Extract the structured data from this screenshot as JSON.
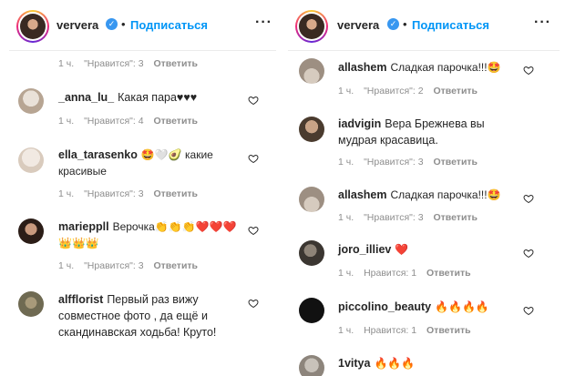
{
  "left": {
    "header": {
      "username": "ververa",
      "follow": "Подписаться",
      "sep": "•",
      "more": "···"
    },
    "top_meta": {
      "time": "1 ч.",
      "likes": "\"Нравится\": 3",
      "reply": "Ответить"
    },
    "comments": [
      {
        "user": "_anna_lu_",
        "text": "Какая пара♥♥♥",
        "time": "1 ч.",
        "likes": "\"Нравится\": 4",
        "reply": "Ответить"
      },
      {
        "user": "ella_tarasenko",
        "text": "🤩🤍🥑 какие красивые",
        "time": "1 ч.",
        "likes": "\"Нравится\": 3",
        "reply": "Ответить"
      },
      {
        "user": "marieppll",
        "text": "Верочка👏👏👏❤️❤️❤️👑👑👑",
        "time": "1 ч.",
        "likes": "\"Нравится\": 3",
        "reply": "Ответить"
      },
      {
        "user": "alfflorist",
        "text": "Первый раз вижу совместное фото , да ещё и скандинавская ходьба! Круто!",
        "time": "",
        "likes": "",
        "reply": ""
      }
    ]
  },
  "right": {
    "header": {
      "username": "ververa",
      "follow": "Подписаться",
      "sep": "•",
      "more": "···"
    },
    "comments": [
      {
        "user": "allashem",
        "text": "Сладкая парочка!!!🤩",
        "time": "1 ч.",
        "likes": "\"Нравится\": 2",
        "reply": "Ответить"
      },
      {
        "user": "iadvigin",
        "text": "Вера Брежнева вы мудрая красавица.",
        "time": "1 ч.",
        "likes": "\"Нравится\": 3",
        "reply": "Ответить"
      },
      {
        "user": "allashem",
        "text": "Сладкая парочка!!!🤩",
        "time": "1 ч.",
        "likes": "\"Нравится\": 3",
        "reply": "Ответить"
      },
      {
        "user": "joro_illiev",
        "text": "❤️",
        "time": "1 ч.",
        "likes": "Нравится: 1",
        "reply": "Ответить"
      },
      {
        "user": "piccolino_beauty",
        "text": "🔥🔥🔥🔥",
        "time": "1 ч.",
        "likes": "Нравится: 1",
        "reply": "Ответить"
      },
      {
        "user": "1vitya",
        "text": "🔥🔥🔥",
        "time": "",
        "likes": "",
        "reply": ""
      }
    ]
  },
  "colors": {
    "link": "#0095f6",
    "muted": "#8e8e8e",
    "text": "#262626",
    "verified": "#3897f0"
  },
  "icons": {
    "verified": "verified-badge-icon",
    "like": "heart-outline-icon",
    "more": "more-options-icon"
  }
}
